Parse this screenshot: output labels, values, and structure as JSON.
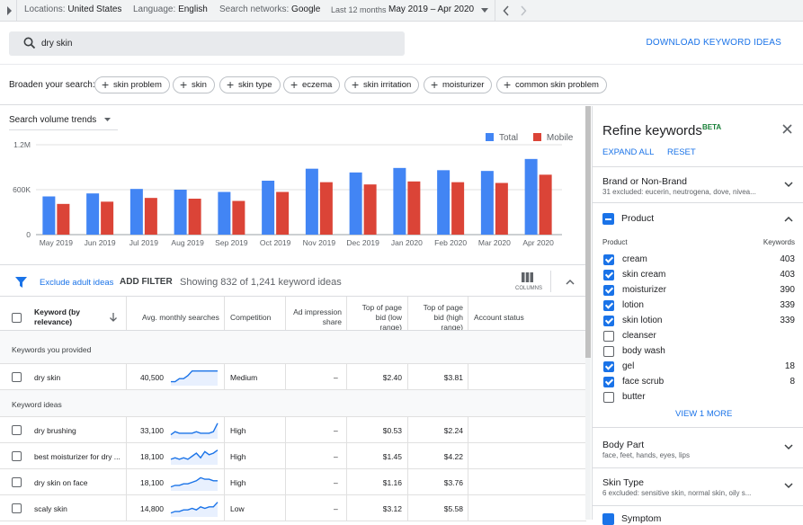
{
  "topbar": {
    "location_label": "Locations:",
    "location_value": "United States",
    "language_label": "Language:",
    "language_value": "English",
    "networks_label": "Search networks:",
    "networks_value": "Google",
    "period_label": "Last 12 months",
    "period_value": "May 2019 – Apr 2020"
  },
  "search": {
    "query": "dry skin",
    "download_label": "DOWNLOAD KEYWORD IDEAS"
  },
  "broaden": {
    "label": "Broaden your search:",
    "chips": [
      "skin problem",
      "skin",
      "skin type",
      "eczema",
      "skin irritation",
      "moisturizer",
      "common skin problem"
    ]
  },
  "trend": {
    "dropdown_label": "Search volume trends"
  },
  "chart_data": {
    "type": "bar",
    "categories": [
      "May 2019",
      "Jun 2019",
      "Jul 2019",
      "Aug 2019",
      "Sep 2019",
      "Oct 2019",
      "Nov 2019",
      "Dec 2019",
      "Jan 2020",
      "Feb 2020",
      "Mar 2020",
      "Apr 2020"
    ],
    "series": [
      {
        "name": "Total",
        "color": "#4285f4",
        "values": [
          510000,
          550000,
          610000,
          600000,
          570000,
          720000,
          880000,
          830000,
          890000,
          860000,
          850000,
          1010000
        ]
      },
      {
        "name": "Mobile",
        "color": "#db4437",
        "values": [
          410000,
          440000,
          490000,
          480000,
          450000,
          570000,
          700000,
          670000,
          710000,
          700000,
          690000,
          800000
        ]
      }
    ],
    "yticks": [
      "0",
      "600K",
      "1.2M"
    ],
    "ylim": [
      0,
      1200000
    ],
    "legend": "top-right",
    "grid": true
  },
  "filters": {
    "exclude_label": "Exclude adult ideas",
    "add_filter_label": "ADD FILTER",
    "showing_text": "Showing 832 of 1,241 keyword ideas",
    "columns_label": "COLUMNS"
  },
  "table": {
    "headers": {
      "keyword": "Keyword (by relevance)",
      "avg": "Avg. monthly searches",
      "competition": "Competition",
      "impression": "Ad impression share",
      "bid_low": "Top of page bid (low range)",
      "bid_high": "Top of page bid (high range)",
      "status": "Account status"
    },
    "group_provided": "Keywords you provided",
    "group_ideas": "Keyword ideas",
    "provided_rows": [
      {
        "keyword": "dry skin",
        "avg": "40,500",
        "competition": "Medium",
        "impression": "–",
        "bid_low": "$2.40",
        "bid_high": "$3.81",
        "trend": [
          0.2,
          0.2,
          0.4,
          0.4,
          0.6,
          0.9,
          0.9,
          0.9,
          0.9,
          0.9,
          0.9,
          0.9
        ]
      }
    ],
    "idea_rows": [
      {
        "keyword": "dry brushing",
        "avg": "33,100",
        "competition": "High",
        "impression": "–",
        "bid_low": "$0.53",
        "bid_high": "$2.24",
        "trend": [
          0.2,
          0.4,
          0.3,
          0.3,
          0.3,
          0.3,
          0.4,
          0.3,
          0.3,
          0.3,
          0.4,
          0.95
        ]
      },
      {
        "keyword": "best moisturizer for dry ...",
        "avg": "18,100",
        "competition": "High",
        "impression": "–",
        "bid_low": "$1.45",
        "bid_high": "$4.22",
        "trend": [
          0.3,
          0.4,
          0.3,
          0.4,
          0.3,
          0.5,
          0.7,
          0.4,
          0.8,
          0.6,
          0.7,
          0.9
        ]
      },
      {
        "keyword": "dry skin on face",
        "avg": "18,100",
        "competition": "High",
        "impression": "–",
        "bid_low": "$1.16",
        "bid_high": "$3.76",
        "trend": [
          0.2,
          0.3,
          0.3,
          0.4,
          0.4,
          0.5,
          0.6,
          0.8,
          0.7,
          0.7,
          0.6,
          0.6
        ]
      },
      {
        "keyword": "scaly skin",
        "avg": "14,800",
        "competition": "Low",
        "impression": "–",
        "bid_low": "$3.12",
        "bid_high": "$5.58",
        "trend": [
          0.2,
          0.3,
          0.3,
          0.4,
          0.4,
          0.5,
          0.4,
          0.6,
          0.5,
          0.6,
          0.6,
          0.9
        ]
      }
    ]
  },
  "refine": {
    "title": "Refine keywords",
    "beta": "BETA",
    "expand_all": "EXPAND ALL",
    "reset": "RESET",
    "brand_title": "Brand or Non-Brand",
    "brand_sub": "31 excluded: eucerin, neutrogena, dove, nivea...",
    "product_title": "Product",
    "product_col": "Product",
    "keywords_col": "Keywords",
    "products": [
      {
        "label": "cream",
        "count": "403",
        "checked": true
      },
      {
        "label": "skin cream",
        "count": "403",
        "checked": true
      },
      {
        "label": "moisturizer",
        "count": "390",
        "checked": true
      },
      {
        "label": "lotion",
        "count": "339",
        "checked": true
      },
      {
        "label": "skin lotion",
        "count": "339",
        "checked": true
      },
      {
        "label": "cleanser",
        "count": "",
        "checked": false
      },
      {
        "label": "body wash",
        "count": "",
        "checked": false
      },
      {
        "label": "gel",
        "count": "18",
        "checked": true
      },
      {
        "label": "face scrub",
        "count": "8",
        "checked": true
      },
      {
        "label": "butter",
        "count": "",
        "checked": false
      }
    ],
    "view_more": "VIEW 1 MORE",
    "body_title": "Body Part",
    "body_sub": "face, feet, hands, eyes, lips",
    "skin_title": "Skin Type",
    "skin_sub": "6 excluded: sensitive skin, normal skin, oily s...",
    "symptom_title": "Symptom"
  }
}
